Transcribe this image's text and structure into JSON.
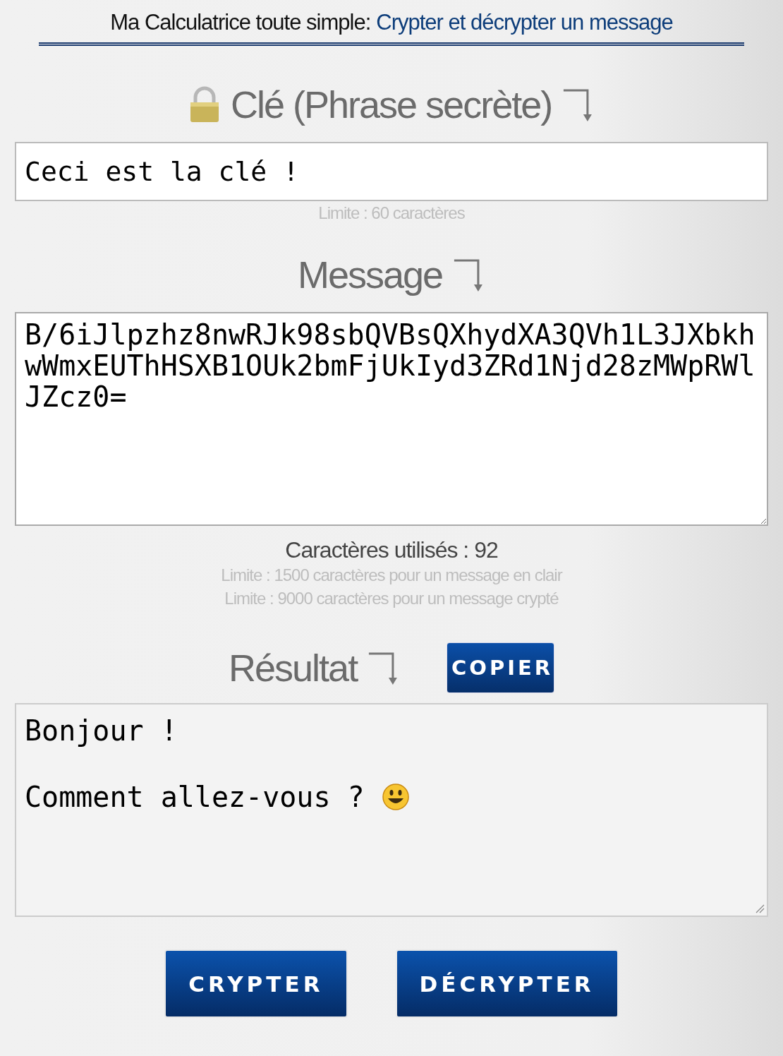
{
  "header": {
    "title_prefix": "Ma Calculatrice toute simple:",
    "title_subject": "Crypter et décrypter un message"
  },
  "key_section": {
    "heading": "Clé (Phrase secrète)",
    "value": "Ceci est la clé !",
    "limit": "Limite : 60 caractères"
  },
  "message_section": {
    "heading": "Message",
    "value": "B/6iJlpzhz8nwRJk98sbQVBsQXhydXA3QVh1L3JXbkhwWmxEUThHSXB1OUk2bmFjUkIyd3ZRd1Njd28zMWpRWlJZcz0=",
    "used": "Caractères utilisés : 92",
    "limits": [
      "Limite : 1500 caractères pour un message en clair",
      "Limite : 9000 caractères pour un message crypté"
    ]
  },
  "result_section": {
    "heading": "Résultat",
    "copy_button": "COPIER",
    "value": "Bonjour !\n\nComment allez-vous ? "
  },
  "buttons": [
    "CRYPTER",
    "DÉCRYPTER"
  ]
}
